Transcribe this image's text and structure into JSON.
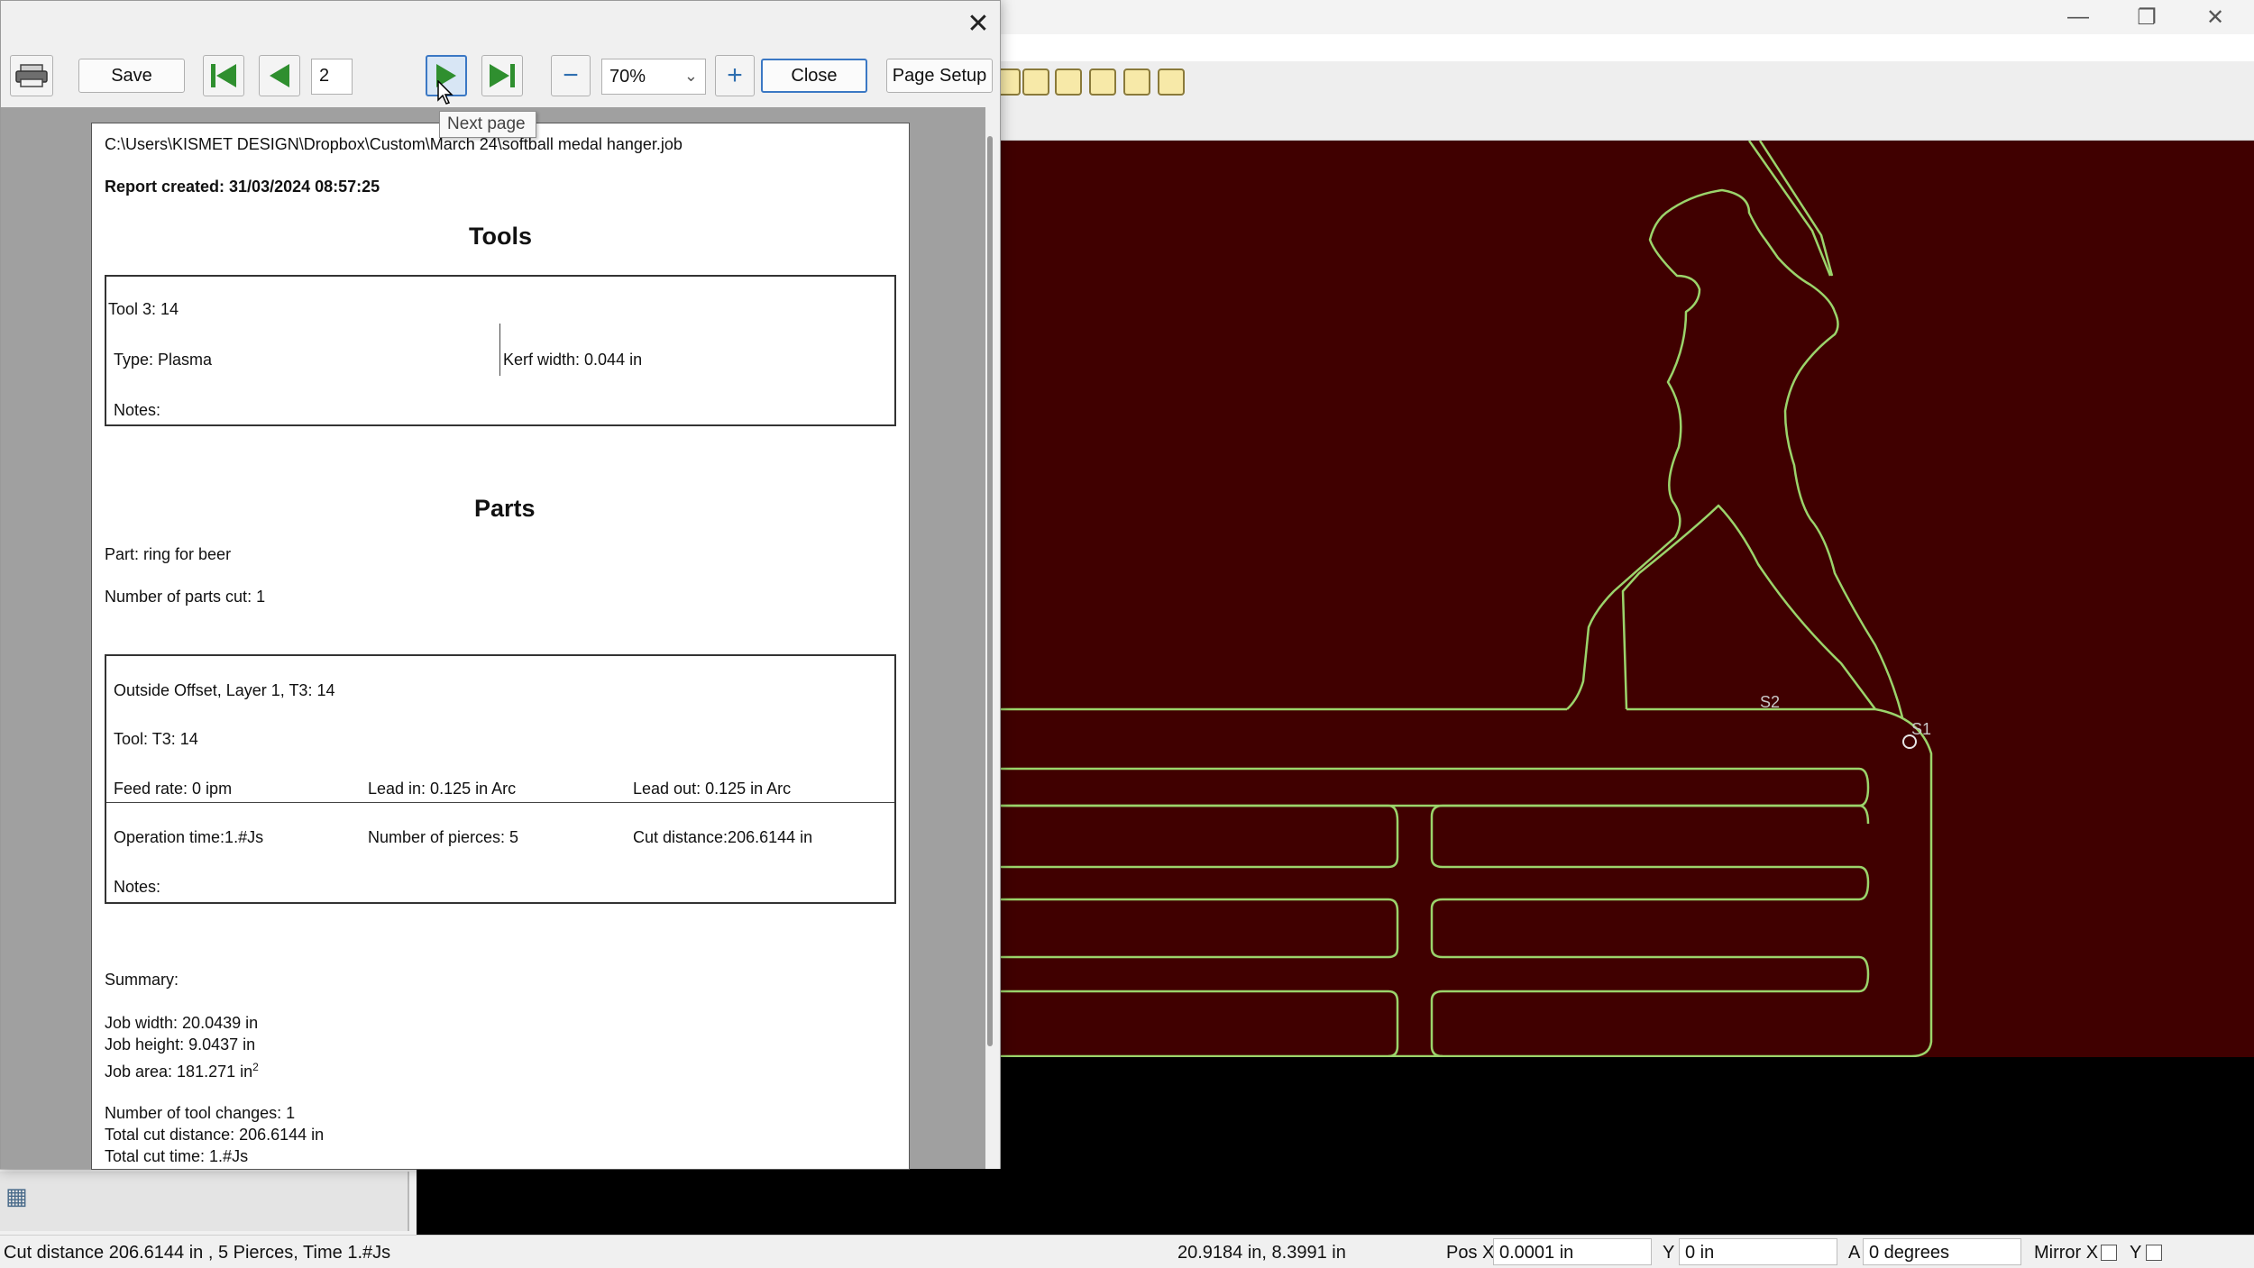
{
  "preview": {
    "toolbar": {
      "print_icon": "printer-icon",
      "save_label": "Save",
      "page_number": "2",
      "zoom_value": "70%",
      "close_label": "Close",
      "page_setup_label": "Page Setup",
      "tooltip": "Next page",
      "nav_color": "#2f8f2f"
    },
    "report": {
      "file_path": "C:\\Users\\KISMET DESIGN\\Dropbox\\Custom\\March 24\\softball medal hanger.job",
      "created": "Report created: 31/03/2024 08:57:25",
      "tools_heading": "Tools",
      "tool": {
        "name": "Tool 3: 14",
        "type": "Type: Plasma",
        "kerf": "Kerf width: 0.044 in",
        "notes": "Notes:"
      },
      "parts_heading": "Parts",
      "part_name": "Part: ring for beer",
      "parts_cut": "Number of parts cut: 1",
      "operation": {
        "title": "Outside Offset, Layer 1, T3: 14",
        "tool": "Tool: T3: 14",
        "feed_rate": "Feed rate: 0 ipm",
        "lead_in": "Lead in: 0.125 in Arc",
        "lead_out": "Lead out: 0.125 in Arc",
        "op_time": "Operation time:1.#Js",
        "pierces": "Number of pierces: 5",
        "cut_distance": "Cut distance:206.6144 in",
        "notes": "Notes:"
      },
      "summary": {
        "heading": "Summary:",
        "job_width": "Job width: 20.0439 in",
        "job_height": "Job height: 9.0437 in",
        "job_area": "Job area: 181.271 in",
        "job_area_sup": "2",
        "tool_changes": "Number of tool changes: 1",
        "total_cut_distance": "Total cut distance: 206.6144 in",
        "total_cut_time": "Total cut time: 1.#Js"
      }
    }
  },
  "canvas": {
    "background_color": "#400000",
    "outline_color": "#9bd46b",
    "start_labels": [
      "S2",
      "S1"
    ]
  },
  "statusbar": {
    "message": "Cut distance 206.6144 in , 5 Pierces, Time 1.#Js",
    "cursor_position": "20.9184 in, 8.3991 in",
    "pos_x_label": "Pos X",
    "pos_x_value": "0.0001 in",
    "y_label": "Y",
    "y_value": "0 in",
    "a_label": "A",
    "a_value": "0 degrees",
    "mirror_x_label": "Mirror X",
    "mirror_y_label": "Y"
  }
}
